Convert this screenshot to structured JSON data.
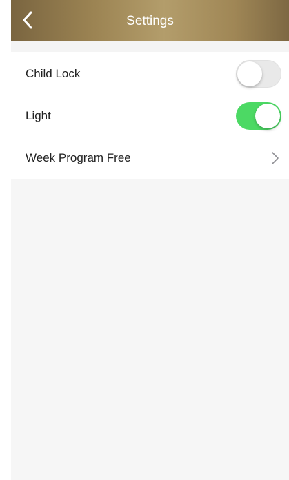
{
  "header": {
    "title": "Settings",
    "back_icon": "chevron-left-icon"
  },
  "settings": {
    "items": [
      {
        "label": "Child Lock",
        "control": "toggle",
        "state": "off"
      },
      {
        "label": "Light",
        "control": "toggle",
        "state": "on"
      },
      {
        "label": "Week Program Free",
        "control": "disclosure",
        "icon": "chevron-right-icon"
      }
    ]
  },
  "colors": {
    "toggle_on": "#4cd964",
    "toggle_off": "#e9e9e9",
    "navbar_gold": "#9c8453"
  }
}
